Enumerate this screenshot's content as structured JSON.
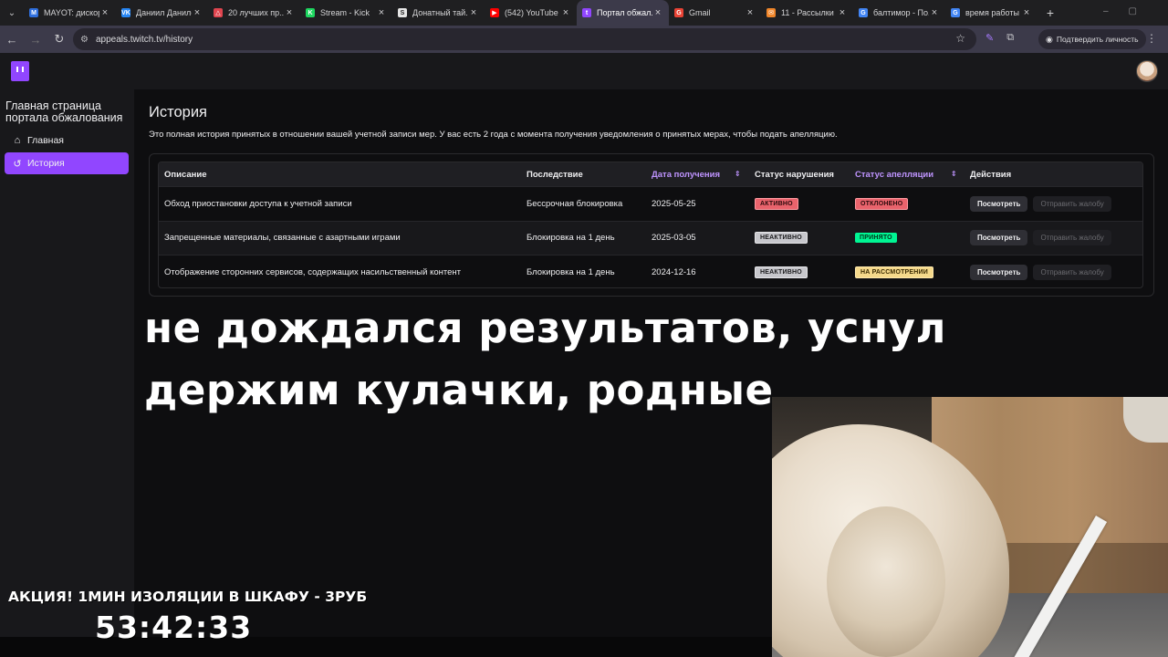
{
  "browser": {
    "tabs": [
      {
        "title": "MAYOT: дискорд",
        "fav_color": "#2f6fde",
        "fav_glyph": "M"
      },
      {
        "title": "Даниил Данилов",
        "fav_color": "#2787f5",
        "fav_glyph": "VK"
      },
      {
        "title": "20 лучших пр...",
        "fav_color": "#e0454f",
        "fav_glyph": "△"
      },
      {
        "title": "Stream - Kick",
        "fav_color": "#1ed760",
        "fav_glyph": "K"
      },
      {
        "title": "Донатный тай...",
        "fav_color": "#e6e6e6",
        "fav_glyph": "S"
      },
      {
        "title": "(542) YouTube",
        "fav_color": "#ff0000",
        "fav_glyph": "▶"
      },
      {
        "title": "Портал обжал...",
        "fav_color": "#9146ff",
        "fav_glyph": "t",
        "active": true
      },
      {
        "title": "Gmail",
        "fav_color": "#ea4335",
        "fav_glyph": "G"
      },
      {
        "title": "11 - Рассылки",
        "fav_color": "#f0862a",
        "fav_glyph": "✉"
      },
      {
        "title": "балтимор - По...",
        "fav_color": "#4285f4",
        "fav_glyph": "G"
      },
      {
        "title": "время работы",
        "fav_color": "#4285f4",
        "fav_glyph": "G"
      }
    ],
    "url": "appeals.twitch.tv/history",
    "verify_label": "Подтвердить личность"
  },
  "sidebar": {
    "title": "Главная страница портала обжалования",
    "items": [
      {
        "label": "Главная",
        "icon": "⌂"
      },
      {
        "label": "История",
        "icon": "↺"
      }
    ]
  },
  "main": {
    "title": "История",
    "description": "Это полная история принятых в отношении вашей учетной записи мер. У вас есть 2 года с момента получения уведомления о принятых мерах, чтобы подать апелляцию.",
    "columns": [
      "Описание",
      "Последствие",
      "Дата получения",
      "Статус нарушения",
      "Статус апелляции",
      "Действия"
    ],
    "rows": [
      {
        "description": "Обход приостановки доступа к учетной записи",
        "consequence": "Бессрочная блокировка",
        "date": "2025-05-25",
        "violation": "АКТИВНО",
        "appeal": "ОТКЛОНЕНО"
      },
      {
        "description": "Запрещенные материалы, связанные с азартными играми",
        "consequence": "Блокировка на 1 день",
        "date": "2025-03-05",
        "violation": "НЕАКТИВНО",
        "appeal": "ПРИНЯТО"
      },
      {
        "description": "Отображение сторонних сервисов, содержащих насильственный контент",
        "consequence": "Блокировка на 1 день",
        "date": "2024-12-16",
        "violation": "НЕАКТИВНО",
        "appeal": "НА РАССМОТРЕНИИ"
      }
    ],
    "view_label": "Посмотреть",
    "appeal_label": "Отправить жалобу"
  },
  "overlay": {
    "caption_line1": "не дождался результатов, уснул",
    "caption_line2": "держим кулачки, родные",
    "promo": "АКЦИЯ! 1МИН ИЗОЛЯЦИИ В ШКАФУ - 3РУБ",
    "timer": "53:42:33"
  }
}
